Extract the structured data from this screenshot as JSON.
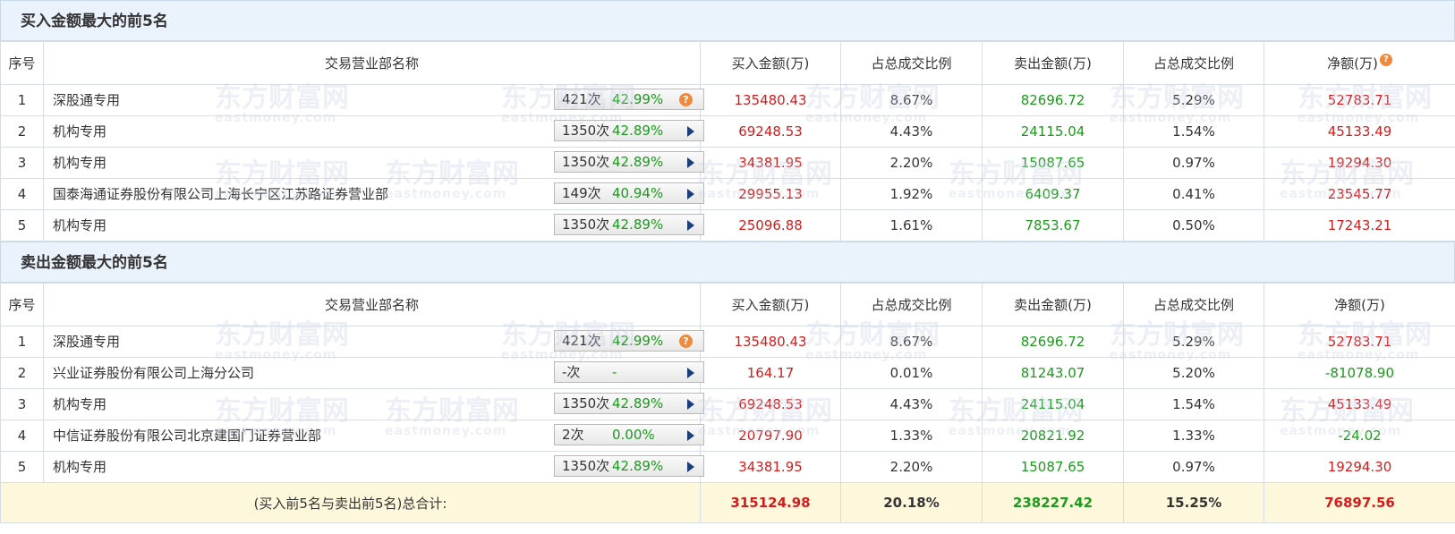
{
  "buy_section": {
    "title": "买入金额最大的前5名",
    "headers": [
      "序号",
      "交易营业部名称",
      "买入金额(万)",
      "占总成交比例",
      "卖出金额(万)",
      "占总成交比例",
      "净额(万)"
    ],
    "rows": [
      {
        "rank": "1",
        "name": "深股通专用",
        "times": "421次",
        "pct": "42.99%",
        "icon": "question",
        "buy": "135480.43",
        "buy_ratio": "8.67%",
        "sell": "82696.72",
        "sell_ratio": "5.29%",
        "net": "52783.71"
      },
      {
        "rank": "2",
        "name": "机构专用",
        "times": "1350次",
        "pct": "42.89%",
        "icon": "arrow",
        "buy": "69248.53",
        "buy_ratio": "4.43%",
        "sell": "24115.04",
        "sell_ratio": "1.54%",
        "net": "45133.49"
      },
      {
        "rank": "3",
        "name": "机构专用",
        "times": "1350次",
        "pct": "42.89%",
        "icon": "arrow",
        "buy": "34381.95",
        "buy_ratio": "2.20%",
        "sell": "15087.65",
        "sell_ratio": "0.97%",
        "net": "19294.30"
      },
      {
        "rank": "4",
        "name": "国泰海通证券股份有限公司上海长宁区江苏路证券营业部",
        "times": "149次",
        "pct": "40.94%",
        "icon": "arrow",
        "buy": "29955.13",
        "buy_ratio": "1.92%",
        "sell": "6409.37",
        "sell_ratio": "0.41%",
        "net": "23545.77"
      },
      {
        "rank": "5",
        "name": "机构专用",
        "times": "1350次",
        "pct": "42.89%",
        "icon": "arrow",
        "buy": "25096.88",
        "buy_ratio": "1.61%",
        "sell": "7853.67",
        "sell_ratio": "0.50%",
        "net": "17243.21"
      }
    ]
  },
  "sell_section": {
    "title": "卖出金额最大的前5名",
    "headers": [
      "序号",
      "交易营业部名称",
      "买入金额(万)",
      "占总成交比例",
      "卖出金额(万)",
      "占总成交比例",
      "净额(万)"
    ],
    "rows": [
      {
        "rank": "1",
        "name": "深股通专用",
        "times": "421次",
        "pct": "42.99%",
        "icon": "question",
        "buy": "135480.43",
        "buy_ratio": "8.67%",
        "sell": "82696.72",
        "sell_ratio": "5.29%",
        "net": "52783.71",
        "net_color": "red"
      },
      {
        "rank": "2",
        "name": "兴业证券股份有限公司上海分公司",
        "times": "-次",
        "pct": "-",
        "icon": "arrow",
        "buy": "164.17",
        "buy_ratio": "0.01%",
        "sell": "81243.07",
        "sell_ratio": "5.20%",
        "net": "-81078.90",
        "net_color": "green"
      },
      {
        "rank": "3",
        "name": "机构专用",
        "times": "1350次",
        "pct": "42.89%",
        "icon": "arrow",
        "buy": "69248.53",
        "buy_ratio": "4.43%",
        "sell": "24115.04",
        "sell_ratio": "1.54%",
        "net": "45133.49",
        "net_color": "red"
      },
      {
        "rank": "4",
        "name": "中信证券股份有限公司北京建国门证券营业部",
        "times": "2次",
        "pct": "0.00%",
        "icon": "arrow",
        "buy": "20797.90",
        "buy_ratio": "1.33%",
        "sell": "20821.92",
        "sell_ratio": "1.33%",
        "net": "-24.02",
        "net_color": "green"
      },
      {
        "rank": "5",
        "name": "机构专用",
        "times": "1350次",
        "pct": "42.89%",
        "icon": "arrow",
        "buy": "34381.95",
        "buy_ratio": "2.20%",
        "sell": "15087.65",
        "sell_ratio": "0.97%",
        "net": "19294.30",
        "net_color": "red"
      }
    ]
  },
  "total": {
    "label": "(买入前5名与卖出前5名)总合计:",
    "buy": "315124.98",
    "buy_ratio": "20.18%",
    "sell": "238227.42",
    "sell_ratio": "15.25%",
    "net": "76897.56"
  },
  "watermark": {
    "cn": "东方财富网",
    "en": "eastmoney.com"
  },
  "colors": {
    "buy": "#d31d1d",
    "sell": "#1b9a1b",
    "header_bg": "#eaf2fb",
    "total_bg": "#fdf8dc"
  }
}
